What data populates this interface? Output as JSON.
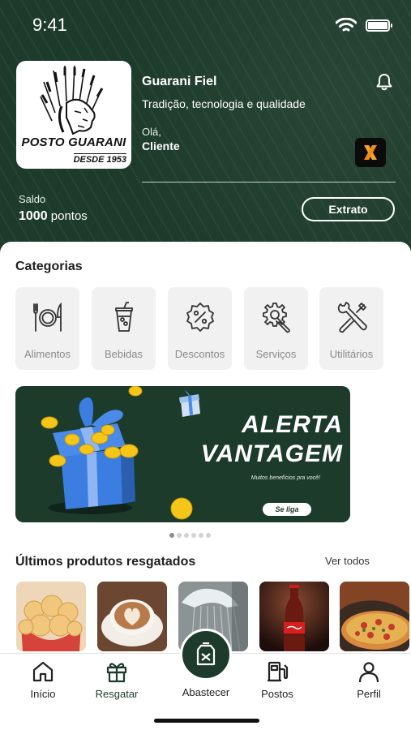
{
  "status_bar": {
    "time": "9:41"
  },
  "header": {
    "logo": {
      "name": "POSTO GUARANI",
      "since": "DESDE 1953"
    },
    "store_name": "Guarani Fiel",
    "tagline": "Tradição, tecnologia e qualidade",
    "greeting": "Olá,",
    "user_name": "Cliente",
    "balance_label": "Saldo",
    "balance_amount": "1000",
    "balance_unit": "pontos",
    "statement_button": "Extrato"
  },
  "categories": {
    "title": "Categorias",
    "items": [
      {
        "label": "Alimentos",
        "icon": "fork-plate-knife-icon"
      },
      {
        "label": "Bebidas",
        "icon": "drink-cup-icon"
      },
      {
        "label": "Descontos",
        "icon": "percent-badge-icon"
      },
      {
        "label": "Serviços",
        "icon": "gear-wrench-icon"
      },
      {
        "label": "Utilitários",
        "icon": "tools-icon"
      }
    ]
  },
  "banner": {
    "title_line1": "ALERTA",
    "title_line2": "VANTAGEM",
    "subtitle": "Muitos benefícios pra você!",
    "cta": "Se liga",
    "dots_total": 6,
    "active_dot": 1
  },
  "redeemed": {
    "title": "Últimos produtos resgatados",
    "see_all": "Ver todos",
    "items": [
      {
        "icon": "cheese-bread-image"
      },
      {
        "icon": "cappuccino-image"
      },
      {
        "icon": "car-wash-image"
      },
      {
        "icon": "coca-cola-bottle-image"
      },
      {
        "icon": "pizza-image"
      }
    ]
  },
  "tabbar": {
    "items": [
      {
        "label": "Início",
        "icon": "home-icon",
        "active": false
      },
      {
        "label": "Resgatar",
        "icon": "gift-icon",
        "active": true
      },
      {
        "label": "Abastecer",
        "icon": "fuel-can-icon",
        "active": false
      },
      {
        "label": "Postos",
        "icon": "gas-station-icon",
        "active": false
      },
      {
        "label": "Perfil",
        "icon": "user-icon",
        "active": false
      }
    ]
  },
  "colors": {
    "brand_green": "#1d3b2b",
    "card_gray": "#f1f1f1",
    "coin_gold": "#f5c518",
    "gift_blue": "#3b7de0"
  }
}
